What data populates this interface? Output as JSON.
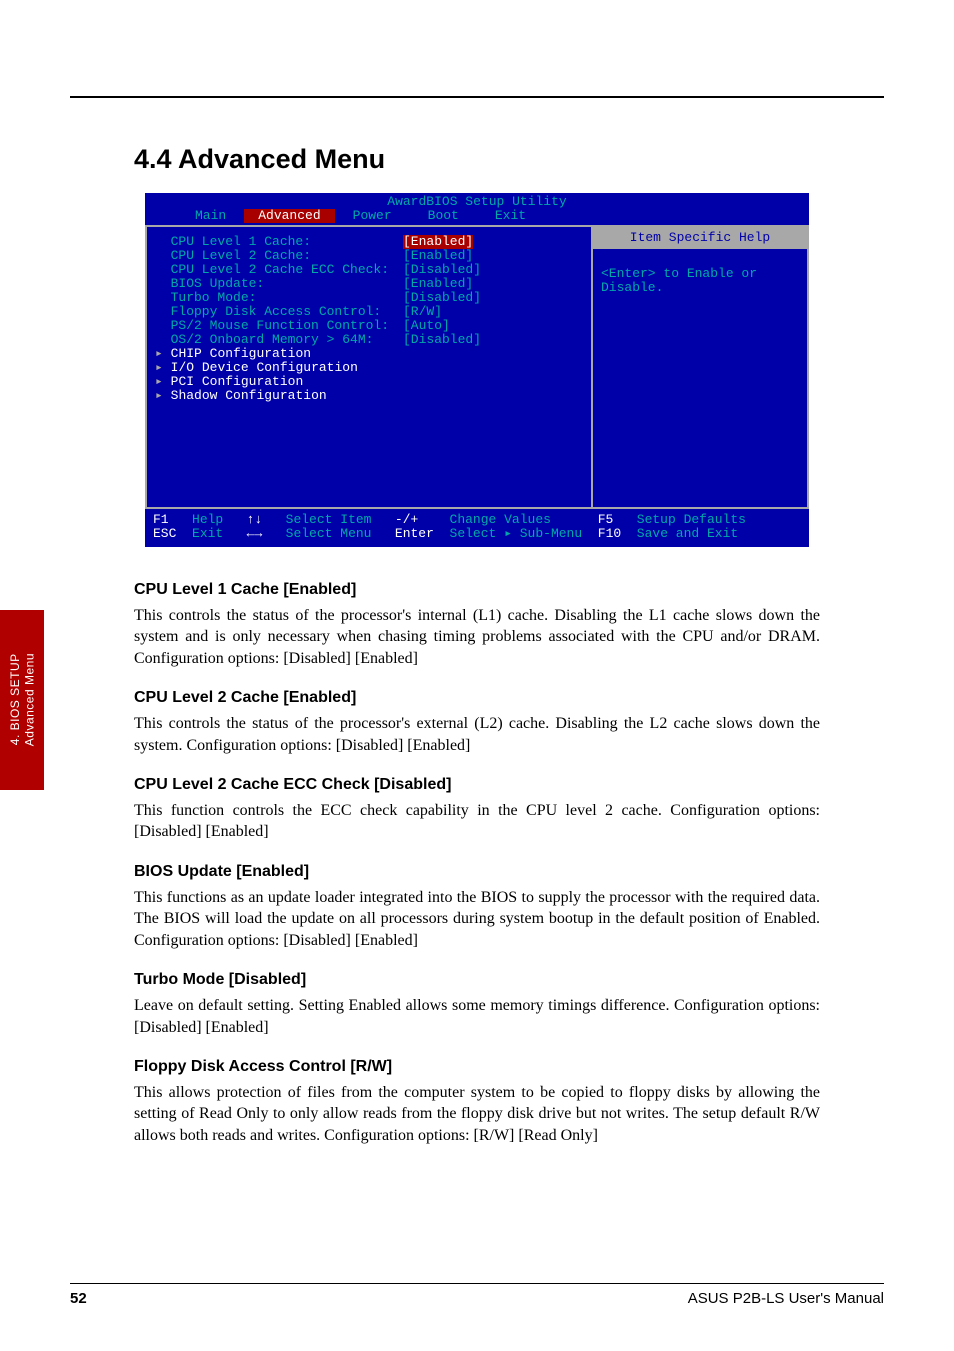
{
  "section": {
    "title": "4.4 Advanced Menu"
  },
  "bios": {
    "title": "AwardBIOS Setup Utility",
    "menu": [
      "Main",
      "Advanced",
      "Power",
      "Boot",
      "Exit"
    ],
    "active_menu": "Advanced",
    "rows": [
      {
        "label": "CPU Level 1 Cache:",
        "value": "[Enabled]",
        "selected": true
      },
      {
        "label": "CPU Level 2 Cache:",
        "value": "[Enabled]"
      },
      {
        "label": "CPU Level 2 Cache ECC Check:",
        "value": "[Disabled]"
      },
      {
        "label": "BIOS Update:",
        "value": "[Enabled]"
      },
      {
        "label": "Turbo Mode:",
        "value": "[Disabled]"
      },
      {
        "label": "Floppy Disk Access Control:",
        "value": "[R/W]"
      },
      {
        "label": "PS/2 Mouse Function Control:",
        "value": "[Auto]"
      },
      {
        "label": "OS/2 Onboard Memory > 64M:",
        "value": "[Disabled]"
      }
    ],
    "subrows": [
      "CHIP Configuration",
      "I/O Device Configuration",
      "PCI Configuration",
      "Shadow Configuration"
    ],
    "help_title": "Item Specific Help",
    "help_body": "<Enter> to Enable or Disable.",
    "footer": {
      "f1": "F1",
      "help": "Help",
      "updown": "↑↓",
      "selitem": "Select Item",
      "pm": "-/+",
      "cv": "Change Values",
      "f5": "F5",
      "sd": "Setup Defaults",
      "esc": "ESC",
      "exit": "Exit",
      "lr": "←→",
      "selmenu": "Select Menu",
      "enter": "Enter",
      "ssm": "Select ▸ Sub-Menu",
      "f10": "F10",
      "se": "Save and Exit"
    }
  },
  "settings": [
    {
      "head": "CPU Level 1 Cache [Enabled]",
      "body": "This controls the status of the processor's internal (L1) cache. Disabling the L1 cache slows down the system and is only necessary when chasing timing problems associated with the CPU and/or DRAM. Configuration options: [Disabled] [Enabled]"
    },
    {
      "head": "CPU Level 2 Cache [Enabled]",
      "body": "This controls the status of the processor's external (L2) cache. Disabling the L2 cache slows down the system. Configuration options: [Disabled] [Enabled]"
    },
    {
      "head": "CPU Level 2 Cache ECC Check [Disabled]",
      "body": "This function controls the ECC check capability in the CPU level 2 cache. Configuration options: [Disabled] [Enabled]"
    },
    {
      "head": "BIOS Update [Enabled]",
      "body": "This functions as an update loader integrated into the BIOS to supply the processor with the required data. The BIOS will load the update on all processors during system bootup in the default position of Enabled. Configuration options: [Disabled] [Enabled]"
    },
    {
      "head": "Turbo Mode [Disabled]",
      "body": "Leave on default setting. Setting Enabled allows some memory timings difference. Configuration options: [Disabled] [Enabled]"
    },
    {
      "head": "Floppy Disk Access Control [R/W]",
      "body": "This allows protection of files from the computer system to be copied to floppy disks by allowing the setting of Read Only to only allow reads from the floppy disk drive but not writes. The setup default R/W allows both reads and writes. Configuration options: [R/W] [Read Only]"
    }
  ],
  "sidebar": {
    "line1": "4. BIOS SETUP",
    "line2": "Advanced Menu"
  },
  "footer": {
    "page": "52",
    "doc": "ASUS P2B-LS User's Manual"
  }
}
